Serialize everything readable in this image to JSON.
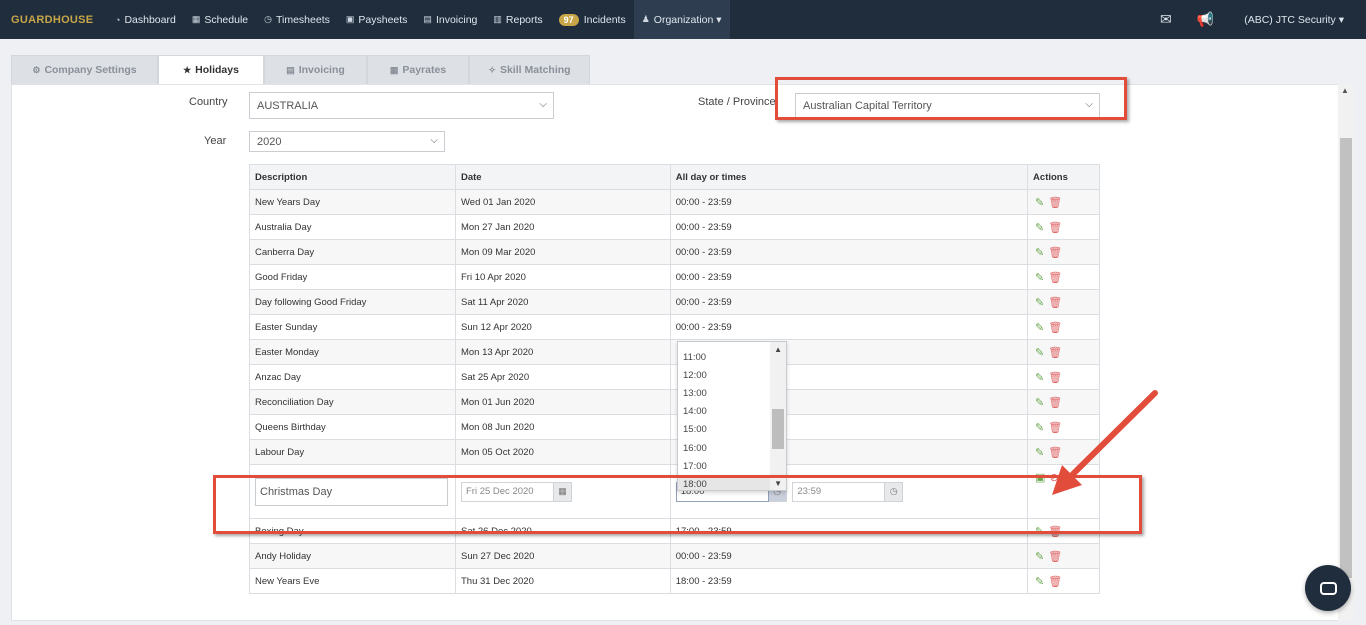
{
  "navbar": {
    "brand": "GUARDHOUSE",
    "items": [
      {
        "icon": "dashboard-icon",
        "glyph": "◔",
        "label": "Dashboard"
      },
      {
        "icon": "calendar-icon",
        "glyph": "▦",
        "label": "Schedule"
      },
      {
        "icon": "clock-icon",
        "glyph": "◷",
        "label": "Timesheets"
      },
      {
        "icon": "money-icon",
        "glyph": "▣",
        "label": "Paysheets"
      },
      {
        "icon": "invoice-icon",
        "glyph": "▤",
        "label": "Invoicing"
      },
      {
        "icon": "reports-icon",
        "glyph": "▥",
        "label": "Reports"
      },
      {
        "icon": "badge",
        "glyph": "",
        "label": "Incidents",
        "badge": "97"
      },
      {
        "icon": "users-icon",
        "glyph": "♟",
        "label": "Organization ▾"
      }
    ],
    "account": "(ABC) JTC Security ▾"
  },
  "tabs": [
    {
      "glyph": "⚙",
      "label": "Company Settings"
    },
    {
      "glyph": "★",
      "label": "Holidays"
    },
    {
      "glyph": "▤",
      "label": "Invoicing"
    },
    {
      "glyph": "▦",
      "label": "Payrates"
    },
    {
      "glyph": "✧",
      "label": "Skill Matching"
    }
  ],
  "filters": {
    "country_label": "Country",
    "country_value": "AUSTRALIA",
    "year_label": "Year",
    "year_value": "2020",
    "state_label": "State / Province",
    "state_value": "Australian Capital Territory"
  },
  "table": {
    "headers": [
      "Description",
      "Date",
      "All day or times",
      "Actions"
    ],
    "rows_before": [
      {
        "desc": "New Years Day",
        "date": "Wed 01 Jan 2020",
        "time": "00:00 - 23:59"
      },
      {
        "desc": "Australia Day",
        "date": "Mon 27 Jan 2020",
        "time": "00:00 - 23:59"
      },
      {
        "desc": "Canberra Day",
        "date": "Mon 09 Mar 2020",
        "time": "00:00 - 23:59"
      },
      {
        "desc": "Good Friday",
        "date": "Fri 10 Apr 2020",
        "time": "00:00 - 23:59"
      },
      {
        "desc": "Day following Good Friday",
        "date": "Sat 11 Apr 2020",
        "time": "00:00 - 23:59"
      },
      {
        "desc": "Easter Sunday",
        "date": "Sun 12 Apr 2020",
        "time": "00:00 - 23:59"
      },
      {
        "desc": "Easter Monday",
        "date": "Mon 13 Apr 2020",
        "time": ""
      },
      {
        "desc": "Anzac Day",
        "date": "Sat 25 Apr 2020",
        "time": ""
      },
      {
        "desc": "Reconciliation Day",
        "date": "Mon 01 Jun 2020",
        "time": ""
      },
      {
        "desc": "Queens Birthday",
        "date": "Mon 08 Jun 2020",
        "time": ""
      },
      {
        "desc": "Labour Day",
        "date": "Mon 05 Oct 2020",
        "time": ""
      }
    ],
    "edit_row": {
      "desc": "Christmas Day",
      "date": "Fri 25 Dec 2020",
      "start": "18:00",
      "end": "23:59"
    },
    "rows_after": [
      {
        "desc": "Boxing Day",
        "date": "Sat 26 Dec 2020",
        "time": "17:00 - 23:59"
      },
      {
        "desc": "Andy Holiday",
        "date": "Sun 27 Dec 2020",
        "time": "00:00 - 23:59"
      },
      {
        "desc": "New Years Eve",
        "date": "Thu 31 Dec 2020",
        "time": "18:00 - 23:59"
      }
    ]
  },
  "time_dropdown": {
    "options": [
      "11:00",
      "12:00",
      "13:00",
      "14:00",
      "15:00",
      "16:00",
      "17:00",
      "18:00"
    ],
    "selected": "18:00"
  },
  "colors": {
    "navbar": "#1f2d3d",
    "brand": "#c8a648",
    "highlight": "#e24d3b",
    "edit": "#6aa84f",
    "delete": "#e06666"
  }
}
